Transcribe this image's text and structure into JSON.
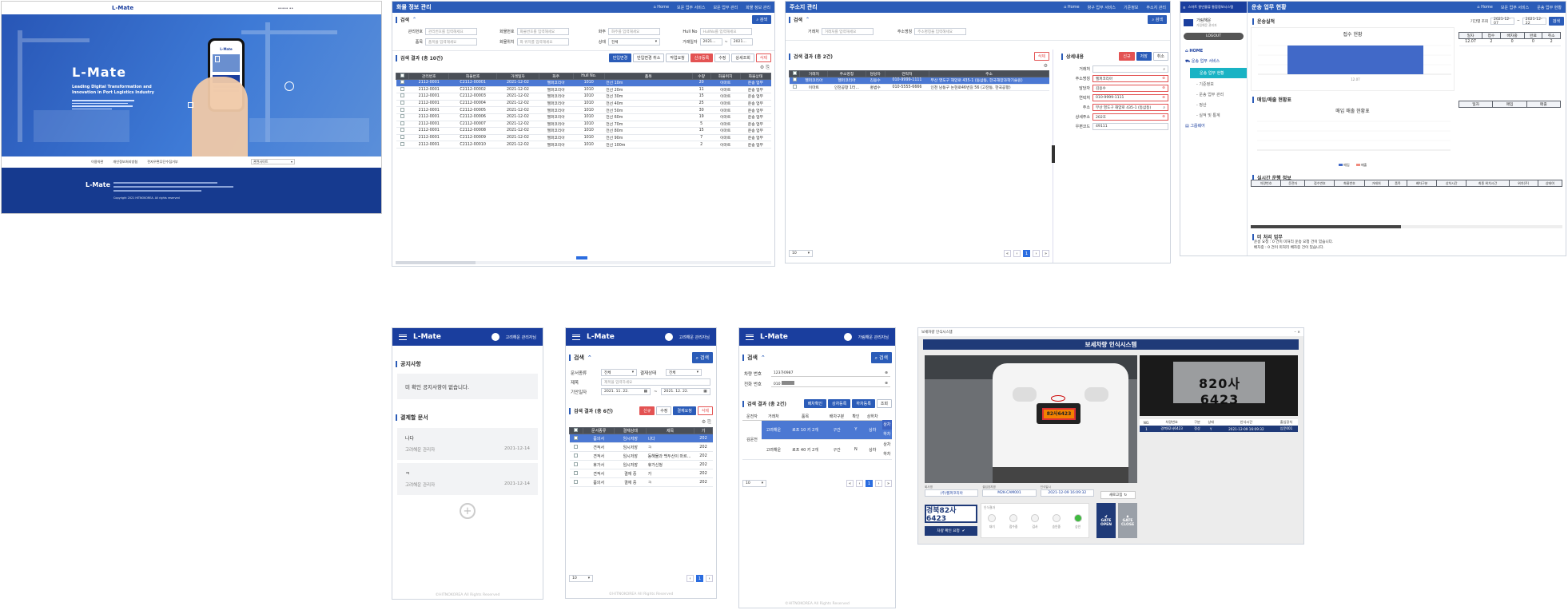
{
  "landing": {
    "logo": "L-Mate",
    "nav": "•••••  ••",
    "hero_title": "L-Mate",
    "hero_sub1": "Leading Digital Transformation and",
    "hero_sub2": "Innovation in Port Logistics Industry",
    "phone_logo": "L-Mate",
    "links": [
      "이용약관",
      "개인정보처리방침",
      "전자우편무단수집거부"
    ],
    "select": "관련사이트",
    "footer_logo": "L-Mate",
    "copyright": "Copyright 2021 HITNOKOREA. All rights reserved"
  },
  "cargo": {
    "title": "화물 정보 관리",
    "crumbs": [
      "Home",
      "보운 업무 서비스",
      "보운 업무 관리",
      "화물 정보 관리"
    ],
    "search_label": "검색",
    "search_btn": "검색",
    "filters": [
      {
        "label": "관리번호",
        "ph": "관리번호를 입력해세요"
      },
      {
        "label": "화물번호",
        "ph": "화물번호를 입력해세요"
      },
      {
        "label": "화주",
        "ph": "화주를 입력해세요"
      },
      {
        "label": "Hull No",
        "ph": "HullNo를 입력해세요"
      },
      {
        "label": "품목",
        "ph": "품목을 입력해세요"
      },
      {
        "label": "화물위치",
        "ph": "화 위치를 입력해세요"
      },
      {
        "label": "상태",
        "ph": "전체"
      },
      {
        "label": "거래일자",
        "ph": "2021..."
      }
    ],
    "result_label": "검색 결과 (총 10건)",
    "actions": [
      "반입변경",
      "반입변경 취소",
      "작업요청",
      "신규등록",
      "수정",
      "상세조회",
      "삭제"
    ],
    "cols": [
      "관리번호",
      "화물번호",
      "거래일자",
      "화주",
      "Hull No.",
      "품목",
      "수량",
      "화물위치",
      "화물상태"
    ],
    "rows": [
      [
        "2112-0001",
        "C2112-00001",
        "2021-12-02",
        "헬퍼코리아",
        "1010",
        "전선 10m",
        "20",
        "이마트",
        "운송 업무"
      ],
      [
        "2112-0001",
        "C2112-00002",
        "2021-12-02",
        "헬퍼코리아",
        "1010",
        "전선 20m",
        "11",
        "이마트",
        "운송 업무"
      ],
      [
        "2112-0001",
        "C2112-00003",
        "2021-12-02",
        "헬퍼코리아",
        "1010",
        "전선 30m",
        "15",
        "이마트",
        "운송 업무"
      ],
      [
        "2112-0001",
        "C2112-00004",
        "2021-12-02",
        "헬퍼코리아",
        "1010",
        "전선 40m",
        "25",
        "이마트",
        "운송 업무"
      ],
      [
        "2112-0001",
        "C2112-00005",
        "2021-12-02",
        "헬퍼코리아",
        "1010",
        "전선 50m",
        "30",
        "이마트",
        "운송 업무"
      ],
      [
        "2112-0001",
        "C2112-00006",
        "2021-12-02",
        "헬퍼코리아",
        "1010",
        "전선 60m",
        "19",
        "이마트",
        "운송 업무"
      ],
      [
        "2112-0001",
        "C2112-00007",
        "2021-12-02",
        "헬퍼코리아",
        "1010",
        "전선 70m",
        "5",
        "이마트",
        "운송 업무"
      ],
      [
        "2112-0001",
        "C2112-00008",
        "2021-12-02",
        "헬퍼코리아",
        "1010",
        "전선 80m",
        "15",
        "이마트",
        "운송 업무"
      ],
      [
        "2112-0001",
        "C2112-00009",
        "2021-12-02",
        "헬퍼코리아",
        "1010",
        "전선 90m",
        "7",
        "이마트",
        "운송 업무"
      ],
      [
        "2112-0001",
        "C2112-00010",
        "2021-12-02",
        "헬퍼코리아",
        "1010",
        "전선 100m",
        "2",
        "이마트",
        "운송 업무"
      ]
    ]
  },
  "addr": {
    "title": "주소지 관리",
    "crumbs": [
      "Home",
      "항구 업무 서비스",
      "기준정보",
      "주소지 관리"
    ],
    "search_label": "검색",
    "search_btn": "검색",
    "f1": "거래처",
    "f1ph": "거래처를 입력해세요",
    "f2": "주소명칭",
    "f2ph": "주소명칭을 입력해세요",
    "result_label": "검색 결과 (총 2건)",
    "del": "삭제",
    "cols": [
      "거래처",
      "주소명칭",
      "담당자",
      "연락처",
      "주소"
    ],
    "rows": [
      [
        "헬퍼코리아",
        "헬퍼코리아",
        "김용수",
        "010-9999-1111",
        "부산 영도구 해양로 435-1 (동삼동, 한국해양과학기술원)"
      ],
      [
        "이마트",
        "인천공항 1터...",
        "홍범수",
        "010-5555-6666",
        "인천 남동구 논현로46번길 56 (고잔동, 한국공항)"
      ]
    ],
    "detail_label": "상세내용",
    "detail_btns": [
      "신규",
      "저장",
      "취소"
    ],
    "detail": [
      {
        "k": "거래처",
        "v": ""
      },
      {
        "k": "주소명칭",
        "v": "헬퍼코리아"
      },
      {
        "k": "담당자",
        "v": "김용수"
      },
      {
        "k": "연락처",
        "v": "010-9999-1111"
      },
      {
        "k": "주소",
        "v": "부산 영도구 해양로 435-1 (동삼동)"
      },
      {
        "k": "상세주소",
        "v": "202호"
      },
      {
        "k": "우편코드",
        "v": "49111"
      }
    ],
    "page_size": "10",
    "page": "1"
  },
  "dash": {
    "sys": "스마트 항만물류 통합정보시스템",
    "title": "운송 업무 현황",
    "crumbs": [
      "Home",
      "보운 업무 서비스",
      "운송 업무 현황"
    ],
    "user": "가림해운",
    "user_sub": "가림해운 관리자",
    "logout": "LOGOUT",
    "menu": [
      "HOME",
      "운송 업무 서비스",
      "운송 업무 현황",
      "기준정보",
      "운송 업무 관리",
      "정산",
      "실적 및 통계",
      "그룹웨어"
    ],
    "perf_label": "운송실적",
    "period_label": "기간별 조회",
    "d1": "2021-12-07",
    "d2": "2021-12-22",
    "search_btn": "검색",
    "chart_title": "접수 현황",
    "bar_x": "12.07",
    "cols": [
      "일자",
      "접수",
      "배차중",
      "완료",
      "취소"
    ],
    "row": [
      "12.07",
      "2",
      "0",
      "0",
      "2"
    ],
    "sales_label": "매입/매출 현황표",
    "sales_title": "매입 매출 현황표",
    "legend": [
      "매입",
      "매출"
    ],
    "sales_cols": [
      "일자",
      "매입",
      "매출"
    ],
    "live_label": "실시간 운행 정보",
    "live_cols": [
      "차량번호",
      "운전자",
      "접수번호",
      "화물번호",
      "거래처",
      "품목",
      "배차구분",
      "상차시간",
      "최종 위치시간",
      "위치(주)",
      "상태여"
    ],
    "notice_label": "미 처리 업무",
    "notice1": "운송 요청 : 0 건이 미처리 운송 요청 건이 있습니다.",
    "notice2": "배차중 : 0 건이 미처리 배차중 건이 있습니다."
  },
  "m1": {
    "logo": "L-Mate",
    "user": "고려해운 관리자님",
    "notice_label": "공지사항",
    "notice_empty": "미 확인 공지사항이 없습니다.",
    "approve_label": "결제할 문서",
    "docs": [
      {
        "t": "나다",
        "who": "고려해운 관리자",
        "d": "2021-12-14"
      },
      {
        "t": "ㅋ",
        "who": "고려해운 관리자",
        "d": "2021-12-14"
      }
    ],
    "footer": "©HITNOKOREA All Rights Reserved"
  },
  "m2": {
    "logo": "L-Mate",
    "user": "고려해운 관리자님",
    "search_label": "검색",
    "search_btn": "검색",
    "f_kind": "문서종류",
    "v_kind": "전체",
    "f_state": "결재상태",
    "v_state": "전체",
    "f_title": "제목",
    "ph_title": "제목을 입력하세요",
    "f_date": "기안일자",
    "d1": "2021. 11. 22.",
    "d2": "2021. 12. 22.",
    "result_label": "검색 결과 (총 6건)",
    "acts": [
      "신규",
      "수정",
      "결재요청",
      "삭제"
    ],
    "cols": [
      "문서종류",
      "결재상태",
      "제목",
      "기"
    ],
    "rows": [
      [
        "품의서",
        "임시저장",
        "나다",
        "202"
      ],
      [
        "견적서",
        "임시저장",
        "ㅋ",
        "202"
      ],
      [
        "견적서",
        "임시저장",
        "동해물과 백두산이 마르...",
        "202"
      ],
      [
        "휴가서",
        "임시저장",
        "휴가신청",
        "202"
      ],
      [
        "견적서",
        "결재 중",
        "가",
        "202"
      ],
      [
        "품의서",
        "결재 중",
        "ㅋ",
        "202"
      ]
    ],
    "page_size": "10",
    "page": "1",
    "footer": "©HITNOKOREA All Rights Reserved"
  },
  "m3": {
    "logo": "L-Mate",
    "user": "가림해운 관리자님",
    "search_label": "검색",
    "search_btn": "검색",
    "f_car": "차량 번호",
    "v_car": "123가0987",
    "f_tel": "전화 번호",
    "v_tel": "010",
    "result_label": "검색 결과 (총 2건)",
    "acts": [
      "배차확인",
      "상차등록",
      "하차등록",
      "조회"
    ],
    "cols": [
      "운전자",
      "거래처",
      "품목",
      "배차구분",
      "확인",
      "상하차"
    ],
    "driver": "김운전",
    "rows": [
      [
        "고려해운",
        "로프 10 키 2개",
        "구간",
        "Y",
        "상차",
        "하차"
      ],
      [
        "고려해운",
        "로프 40 키 2개",
        "구간",
        "N",
        "상차",
        "하차"
      ]
    ],
    "page_size": "10",
    "page": "1",
    "footer": "©HITNOKOREA All Rights Reserved"
  },
  "gate": {
    "win": "보세차량 인식시스템",
    "title": "보세차량 인식시스템",
    "plate_main": "82사6423",
    "plate_crop": "820사 6423",
    "cols": [
      "NO.",
      "차량번호",
      "구분",
      "상태",
      "인식시간",
      "출입장치"
    ],
    "row": [
      "1",
      "경북82사6423",
      "정상",
      "Y",
      "2021-12-09 16:09:32",
      "입문001"
    ],
    "info_labels": [
      "회사명",
      "출입장치명",
      "인식일시"
    ],
    "company": "(주)헬퍼코리아",
    "device": "M2K-CAM001",
    "time": "2021-12-09 16:09:32",
    "refresh": "새로고침",
    "plate": "경북82사6423",
    "check_btn": "차량 확인 요청",
    "steps_label": "인식결과",
    "steps": [
      "대기",
      "접수중",
      "검사",
      "승인중",
      "승인"
    ],
    "open": "GATE OPEN",
    "close": "GATE CLOSE"
  }
}
